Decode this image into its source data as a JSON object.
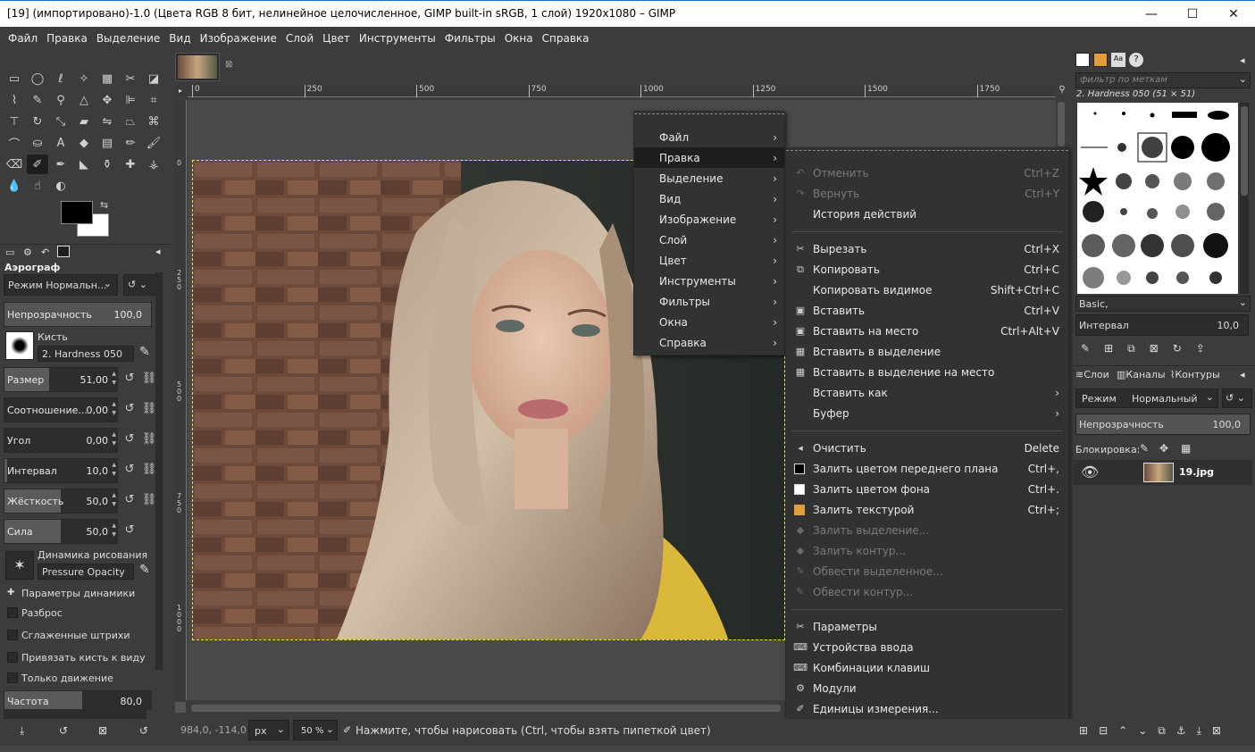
{
  "window": {
    "title": "[19] (импортировано)-1.0 (Цвета RGB 8 бит, нелинейное целочисленное, GIMP built-in sRGB, 1 слой) 1920x1080 – GIMP",
    "minimize": "—",
    "maximize": "☐",
    "close": "✕"
  },
  "menubar": [
    "Файл",
    "Правка",
    "Выделение",
    "Вид",
    "Изображение",
    "Слой",
    "Цвет",
    "Инструменты",
    "Фильтры",
    "Окна",
    "Справка"
  ],
  "tool_options": {
    "title": "Аэрограф",
    "mode_label": "Режим Нормальн...",
    "opacity": {
      "label": "Непрозрачность",
      "value": "100,0"
    },
    "brush_label": "Кисть",
    "brush_name": "2. Hardness 050",
    "sliders": [
      {
        "label": "Размер",
        "value": "51,00"
      },
      {
        "label": "Соотношение...",
        "value": "0,00"
      },
      {
        "label": "Угол",
        "value": "0,00"
      },
      {
        "label": "Интервал",
        "value": "10,0"
      },
      {
        "label": "Жёсткость",
        "value": "50,0"
      },
      {
        "label": "Сила",
        "value": "50,0"
      }
    ],
    "dynamics_label": "Динамика рисования",
    "dynamics_name": "Pressure Opacity",
    "checks": [
      "Параметры динамики",
      "Разброс",
      "Сглаженные штрихи",
      "Привязать кисть к виду",
      "Только движение"
    ],
    "rate": {
      "label": "Частота",
      "value": "80,0"
    }
  },
  "ruler": {
    "h": [
      "0",
      "250",
      "500",
      "750",
      "1000",
      "1250",
      "1500",
      "1750"
    ],
    "v": [
      "0",
      "2\n5\n0",
      "5\n0\n0",
      "7\n5\n0",
      "1\n0\n0\n0"
    ]
  },
  "context_menu": {
    "items": [
      "Файл",
      "Правка",
      "Выделение",
      "Вид",
      "Изображение",
      "Слой",
      "Цвет",
      "Инструменты",
      "Фильтры",
      "Окна",
      "Справка"
    ],
    "highlighted": "Правка"
  },
  "edit_submenu": [
    {
      "label": "Отменить",
      "shortcut": "Ctrl+Z",
      "icon": "undo-icon",
      "disabled": true
    },
    {
      "label": "Вернуть",
      "shortcut": "Ctrl+Y",
      "icon": "redo-icon",
      "disabled": true
    },
    {
      "label": "История действий",
      "shortcut": "",
      "icon": "history-icon",
      "disabled": false
    },
    {
      "sep": true
    },
    {
      "label": "Вырезать",
      "shortcut": "Ctrl+X",
      "icon": "cut-icon",
      "disabled": false
    },
    {
      "label": "Копировать",
      "shortcut": "Ctrl+C",
      "icon": "copy-icon",
      "disabled": false
    },
    {
      "label": "Копировать видимое",
      "shortcut": "Shift+Ctrl+C",
      "icon": "",
      "disabled": false
    },
    {
      "label": "Вставить",
      "shortcut": "Ctrl+V",
      "icon": "paste-icon",
      "disabled": false
    },
    {
      "label": "Вставить на место",
      "shortcut": "Ctrl+Alt+V",
      "icon": "paste-icon",
      "disabled": false
    },
    {
      "label": "Вставить в выделение",
      "shortcut": "",
      "icon": "paste-into-icon",
      "disabled": false
    },
    {
      "label": "Вставить в выделение на место",
      "shortcut": "",
      "icon": "paste-into-icon",
      "disabled": false
    },
    {
      "label": "Вставить как",
      "shortcut": "",
      "icon": "",
      "disabled": false,
      "submenu": true
    },
    {
      "label": "Буфер",
      "shortcut": "",
      "icon": "",
      "disabled": false,
      "submenu": true
    },
    {
      "sep": true
    },
    {
      "label": "Очистить",
      "shortcut": "Delete",
      "icon": "clear-icon",
      "disabled": false
    },
    {
      "label": "Залить цветом переднего плана",
      "shortcut": "Ctrl+,",
      "icon": "fg-fill-icon",
      "disabled": false
    },
    {
      "label": "Залить цветом фона",
      "shortcut": "Ctrl+.",
      "icon": "bg-fill-icon",
      "disabled": false
    },
    {
      "label": "Залить текстурой",
      "shortcut": "Ctrl+;",
      "icon": "pattern-fill-icon",
      "disabled": false
    },
    {
      "label": "Залить выделение...",
      "shortcut": "",
      "icon": "bucket-icon",
      "disabled": true
    },
    {
      "label": "Залить контур...",
      "shortcut": "",
      "icon": "bucket-icon",
      "disabled": true
    },
    {
      "label": "Обвести выделенное...",
      "shortcut": "",
      "icon": "stroke-icon",
      "disabled": true
    },
    {
      "label": "Обвести контур...",
      "shortcut": "",
      "icon": "stroke-icon",
      "disabled": true
    },
    {
      "sep": true
    },
    {
      "label": "Параметры",
      "shortcut": "",
      "icon": "preferences-icon",
      "disabled": false
    },
    {
      "label": "Устройства ввода",
      "shortcut": "",
      "icon": "input-devices-icon",
      "disabled": false
    },
    {
      "label": "Комбинации клавиш",
      "shortcut": "",
      "icon": "keyboard-icon",
      "disabled": false
    },
    {
      "label": "Модули",
      "shortcut": "",
      "icon": "modules-icon",
      "disabled": false
    },
    {
      "label": "Единицы измерения...",
      "shortcut": "",
      "icon": "units-icon",
      "disabled": false
    }
  ],
  "statusbar": {
    "coords": "984,0, -114,0",
    "unit": "px",
    "zoom": "50 %",
    "message": "Нажмите, чтобы нарисовать (Ctrl, чтобы взять пипеткой цвет)"
  },
  "brushes_panel": {
    "filter_placeholder": "фильтр по меткам",
    "selected_brush": "2. Hardness 050 (51 × 51)",
    "preset": "Basic,",
    "spacing": {
      "label": "Интервал",
      "value": "10,0"
    }
  },
  "layers_panel": {
    "tabs": [
      "Слои",
      "Каналы",
      "Контуры"
    ],
    "mode_label": "Режим",
    "mode_value": "Нормальный",
    "opacity": {
      "label": "Непрозрачность",
      "value": "100,0"
    },
    "lock_label": "Блокировка:",
    "layer_name": "19.jpg"
  },
  "colors": {
    "accent": "#1e1e1e",
    "selection": "#e8e84a"
  }
}
